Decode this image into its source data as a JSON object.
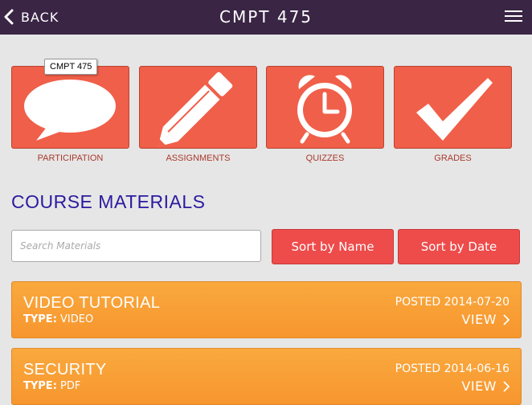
{
  "header": {
    "back_label": "BACK",
    "title": "CMPT 475"
  },
  "tooltip": "CMPT 475",
  "tiles": [
    {
      "label": "PARTICIPATION",
      "icon": "speech-bubble-icon"
    },
    {
      "label": "ASSIGNMENTS",
      "icon": "pencil-icon"
    },
    {
      "label": "QUIZZES",
      "icon": "alarm-clock-icon"
    },
    {
      "label": "GRADES",
      "icon": "checkmark-icon"
    }
  ],
  "materials": {
    "section_title": "COURSE MATERIALS",
    "search_placeholder": "Search Materials",
    "sort_name_label": "Sort by Name",
    "sort_date_label": "Sort by Date",
    "items": [
      {
        "title": "VIDEO TUTORIAL",
        "type_label": "TYPE:",
        "type": "VIDEO",
        "posted": "POSTED 2014-07-20",
        "view": "VIEW"
      },
      {
        "title": "SECURITY",
        "type_label": "TYPE:",
        "type": "PDF",
        "posted": "POSTED 2014-06-16",
        "view": "VIEW"
      }
    ]
  },
  "colors": {
    "header_bg": "#3a2545",
    "tile_red": "#f05f49",
    "sort_button_red": "#ee4b4b",
    "card_orange": "#f7962e",
    "section_title_blue": "#2b1aa0"
  }
}
